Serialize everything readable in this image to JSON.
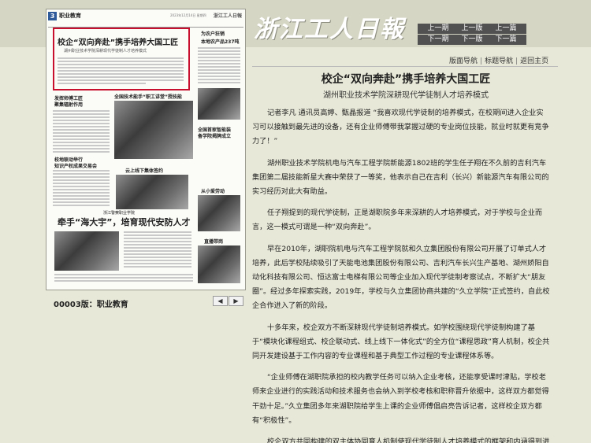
{
  "masthead": {
    "logo": "浙江工人日報",
    "prev_issue": "上一期",
    "next_issue": "下一期",
    "prev_page": "上一版",
    "next_page": "下一版",
    "prev_article": "上一篇",
    "next_article": "下一篇"
  },
  "thumbnail": {
    "page_num": "3",
    "section": "职业教育",
    "date": "2023年12月14日 星期四",
    "mini_logo": "浙江工人日報",
    "headline": "校企“双向奔赴”携手培养大国工匠",
    "headline_sub": "湖州职业技术学院深耕现代学徒制人才培养模式",
    "side_title1": "为农户狂销",
    "side_title2": "本地农产品237吨",
    "sub1": "发挥师傅工匠",
    "sub1b": "聚集辐射作用",
    "sub2": "全国技术能手“职工讲堂”授技能",
    "sub3": "全国首家智能装",
    "sub3b": "备学院揭牌成立",
    "sub4": "校地联动举行",
    "sub4b": "知识产权成果交易会",
    "sub5": "云上线下集体签约",
    "sub6": "从小爱劳动",
    "sub7": "浙江警察职业学院",
    "bottom_title": "牵手“海大宇”，培育现代安防人才",
    "sub8": "直播带岗",
    "caption": "00003版：职业教育",
    "arrow_prev": "◀",
    "arrow_next": "▶"
  },
  "nav_links": [
    "版面导航",
    "标题导航",
    "返回主页"
  ],
  "article": {
    "title": "校企“双向奔赴”携手培养大国工匠",
    "subtitle": "湖州职业技术学院深耕现代学徒制人才培养模式",
    "paragraphs": [
      "记者李凡 通讯员高婷、甄晶报道 “我喜欢现代学徒制的培养模式，在校期间进入企业实习可以接触到最先进的设备，还有企业师傅带我掌握过硬的专业岗位技能，就业时就更有竞争力了！”",
      "湖州职业技术学院机电与汽车工程学院新能源1802班的学生任子翔在不久前的吉利汽车集团第二届技能新星大赛中荣获了一等奖，他表示自己在吉利（长兴）新能源汽车有限公司的实习经历对此大有助益。",
      "任子翔提到的现代学徒制，正是湖职院多年来深耕的人才培养模式，对于学校与企业而言，这一模式可谓是一种“双向奔赴”。",
      "早在2010年，湖职院机电与汽车工程学院就和久立集团股份有限公司开展了订单式人才培养，此后学校陆续吸引了天能电池集团股份有限公司、吉利汽车长兴生产基地、湖州娇阳自动化科技有限公司、恒达富士电梯有限公司等企业加入现代学徒制考察试点，不断扩大“朋友圈”。经过多年探索实践，2019年，学校与久立集团协商共建的“久立学院”正式签约，自此校企合作进入了新的阶段。",
      "十多年来，校企双方不断深耕现代学徒制培养模式。如学校围绕现代学徒制构建了基于“模块化课程组式、校企联动式、线上线下一体化式”的全方位“课程思政”育人机制，校企共同开发建设基于工作内容的专业课程和基于典型工作过程的专业课程体系等。",
      "“企业师傅在湖职院承担的校内教学任务可以纳入企业考核，还能享受课时津贴，学校老师来企业进行的实践活动和技术服务也会纳入到学校考核和职称晋升依据中，这样双方都觉得干劲十足。”久立集团多年来湖职院给学生上课的企业师傅倡启亮告诉记者，这样校企双方都有“积极性”。",
      "校企双方共同构建的双主体协同育人机制使现代学徒制人才培养模式的框架和内涵得到进一步延伸，改革也取得了明显的成效：学校超半数毕业后留在湖州本地工作；久立集团等"
    ]
  }
}
